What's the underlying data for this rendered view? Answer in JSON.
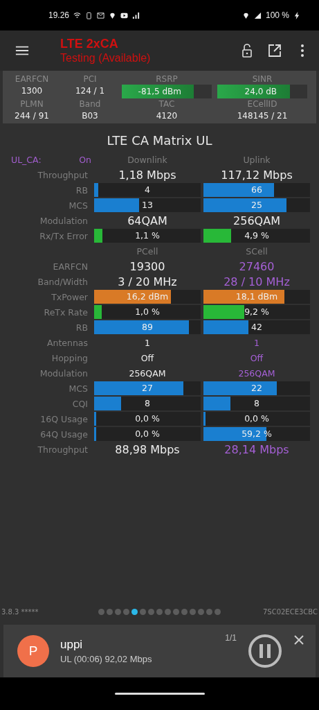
{
  "status_bar": {
    "time": "19.26",
    "battery": "100 %"
  },
  "app_bar": {
    "title": "LTE 2xCA",
    "subtitle": "Testing (Available)"
  },
  "cell_info": {
    "rows": [
      {
        "cells": [
          {
            "label": "EARFCN",
            "value": "1300"
          },
          {
            "label": "PCI",
            "value": "124 / 1"
          },
          {
            "label": "RSRP",
            "value": "-81,5 dBm",
            "level": 0.8
          },
          {
            "label": "SINR",
            "value": "24,0 dB",
            "level": 0.81
          }
        ]
      },
      {
        "cells": [
          {
            "label": "PLMN",
            "value": "244 / 91"
          },
          {
            "label": "Band",
            "value": "B03"
          },
          {
            "label": "TAC",
            "value": "4120"
          },
          {
            "label": "ECellID",
            "value": "148145 / 21"
          }
        ]
      }
    ]
  },
  "matrix": {
    "title": "LTE CA Matrix UL",
    "sections": [
      {
        "header": {
          "label": "UL_CA:",
          "state": "On",
          "columns": [
            "Downlink",
            "Uplink"
          ]
        },
        "rows": [
          {
            "label": "Throughput",
            "kind": "big",
            "cells": [
              {
                "text": "1,18 Mbps",
                "accent": false
              },
              {
                "text": "117,12 Mbps",
                "accent": false
              }
            ]
          },
          {
            "label": "RB",
            "kind": "bar",
            "cells": [
              {
                "text": "4",
                "level": 0.04,
                "color": "#1a7fd0"
              },
              {
                "text": "66",
                "level": 0.66,
                "color": "#1a7fd0"
              }
            ]
          },
          {
            "label": "MCS",
            "kind": "bar",
            "cells": [
              {
                "text": "13",
                "level": 0.42,
                "color": "#1a7fd0"
              },
              {
                "text": "25",
                "level": 0.78,
                "color": "#1a7fd0"
              }
            ]
          },
          {
            "label": "Modulation",
            "kind": "big",
            "cells": [
              {
                "text": "64QAM",
                "accent": false
              },
              {
                "text": "256QAM",
                "accent": false
              }
            ]
          },
          {
            "label": "Rx/Tx Error",
            "kind": "bar",
            "cells": [
              {
                "text": "1,1 %",
                "level": 0.08,
                "color": "#28b838"
              },
              {
                "text": "4,9 %",
                "level": 0.26,
                "color": "#28b838"
              }
            ]
          }
        ]
      },
      {
        "header": {
          "columns": [
            "PCell",
            "SCell"
          ]
        },
        "rows": [
          {
            "label": "EARFCN",
            "kind": "big",
            "cells": [
              {
                "text": "19300",
                "accent": false
              },
              {
                "text": "27460",
                "accent": true
              }
            ]
          },
          {
            "label": "Band/Width",
            "kind": "big",
            "cells": [
              {
                "text": "3 / 20 MHz",
                "accent": false
              },
              {
                "text": "28 / 10 MHz",
                "accent": true
              }
            ]
          },
          {
            "label": "TxPower",
            "kind": "bar",
            "cells": [
              {
                "text": "16,2 dBm",
                "level": 0.72,
                "color": "#d97a26"
              },
              {
                "text": "18,1 dBm",
                "level": 0.76,
                "color": "#d97a26"
              }
            ]
          },
          {
            "label": "ReTx Rate",
            "kind": "bar",
            "cells": [
              {
                "text": "1,0 %",
                "level": 0.07,
                "color": "#28b838"
              },
              {
                "text": "9,2 %",
                "level": 0.38,
                "color": "#28b838"
              }
            ]
          },
          {
            "label": "RB",
            "kind": "bar",
            "cells": [
              {
                "text": "89",
                "level": 0.89,
                "color": "#1a7fd0"
              },
              {
                "text": "42",
                "level": 0.42,
                "color": "#1a7fd0"
              }
            ]
          },
          {
            "label": "Antennas",
            "kind": "small",
            "cells": [
              {
                "text": "1",
                "accent": false
              },
              {
                "text": "1",
                "accent": true
              }
            ]
          },
          {
            "label": "Hopping",
            "kind": "small",
            "cells": [
              {
                "text": "Off",
                "accent": false
              },
              {
                "text": "Off",
                "accent": true
              }
            ]
          },
          {
            "label": "Modulation",
            "kind": "small",
            "cells": [
              {
                "text": "256QAM",
                "accent": false
              },
              {
                "text": "256QAM",
                "accent": true
              }
            ]
          },
          {
            "label": "MCS",
            "kind": "bar",
            "cells": [
              {
                "text": "27",
                "level": 0.84,
                "color": "#1a7fd0"
              },
              {
                "text": "22",
                "level": 0.69,
                "color": "#1a7fd0"
              }
            ]
          },
          {
            "label": "CQI",
            "kind": "bar",
            "cells": [
              {
                "text": "8",
                "level": 0.25,
                "color": "#1a7fd0"
              },
              {
                "text": "8",
                "level": 0.25,
                "color": "#1a7fd0"
              }
            ]
          },
          {
            "label": "16Q Usage",
            "kind": "bar",
            "cells": [
              {
                "text": "0,0 %",
                "level": 0.02,
                "color": "#1a7fd0"
              },
              {
                "text": "0,0 %",
                "level": 0.02,
                "color": "#1a7fd0"
              }
            ]
          },
          {
            "label": "64Q Usage",
            "kind": "bar",
            "cells": [
              {
                "text": "0,0 %",
                "level": 0.02,
                "color": "#1a7fd0"
              },
              {
                "text": "59,2 %",
                "level": 0.59,
                "color": "#1a7fd0"
              }
            ]
          },
          {
            "label": "Throughput",
            "kind": "big",
            "cells": [
              {
                "text": "88,98 Mbps",
                "accent": false
              },
              {
                "text": "28,14 Mbps",
                "accent": true
              }
            ]
          }
        ]
      }
    ]
  },
  "footer": {
    "version": "3.8.3 *****",
    "code": "7SC02ECE3CBC",
    "pages": [
      {
        "selected": false
      },
      {
        "selected": false
      },
      {
        "selected": false
      },
      {
        "selected": false
      },
      {
        "selected": true
      },
      {
        "selected": false
      },
      {
        "selected": false
      },
      {
        "selected": false
      },
      {
        "selected": false
      },
      {
        "selected": false
      },
      {
        "selected": false
      },
      {
        "selected": false
      },
      {
        "selected": false
      },
      {
        "selected": false
      },
      {
        "selected": false
      }
    ]
  },
  "notification": {
    "avatar": "P",
    "title": "uppi",
    "text": "UL (00:06) 92,02 Mbps",
    "count": "1/1"
  }
}
